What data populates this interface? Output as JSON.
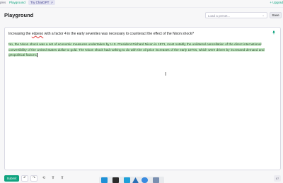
{
  "nav": {
    "cut_item": "ples",
    "active_item": "Playground",
    "chip_label": "Try ChatGPT",
    "chip_icon": "external-link-icon",
    "upgrade_label": "+ Upgrad"
  },
  "header": {
    "title": "Playground",
    "preset_placeholder": "Load a preset...",
    "save_label": "Save"
  },
  "editor": {
    "prompt_before": "Increasing the ",
    "prompt_misspelled": "edpeso",
    "prompt_after": " with a factor 4 in the early seventies was necessary to counteract the effect of the Nixon shock?",
    "completion": "No, the Nixon shock was a set of economic measures undertaken by U.S. President Richard Nixon in 1971, most notably the unilateral cancellation of the direct international convertibility of the United States dollar to gold. The Nixon shock had nothing to do with the oil price increases of the early 1970s, which were driven by increased demand and geopolitical factors."
  },
  "footer": {
    "submit_label": "Submit",
    "undo_icon": "undo-icon",
    "redo_icon": "redo-icon",
    "history_icon": "history-icon",
    "thumbs_down_icon": "thumbs-down-icon",
    "thumbs_up_icon": "thumbs-up-icon",
    "token_count": "67"
  },
  "colors": {
    "accent": "#10a37f",
    "highlight": "#c9edc9"
  }
}
